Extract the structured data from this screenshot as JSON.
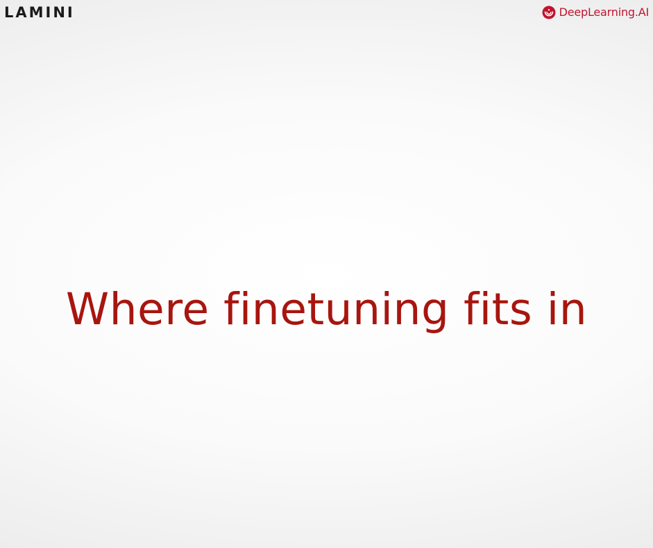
{
  "header": {
    "left_logo_text": "LAMINI",
    "right_logo_text": "DeepLearning.AI",
    "right_logo_icon": "deeplearning-ai-icon"
  },
  "slide": {
    "title": "Where finetuning fits in"
  },
  "colors": {
    "title": "#a8150f",
    "brand_red": "#c0152f",
    "lamini_text": "#1a1a1a"
  }
}
